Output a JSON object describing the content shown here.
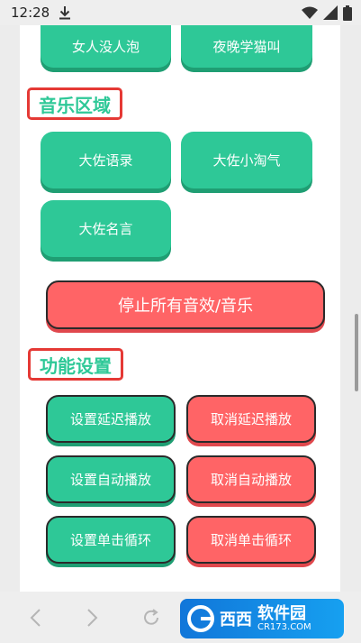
{
  "status_bar": {
    "time": "12:28"
  },
  "buttons_top": [
    {
      "label": "女人没人泡"
    },
    {
      "label": "夜晚学猫叫"
    }
  ],
  "music_section": {
    "title": "音乐区域",
    "buttons": [
      {
        "label": "大佐语录"
      },
      {
        "label": "大佐小淘气"
      },
      {
        "label": "大佐名言"
      }
    ]
  },
  "stop_button": {
    "label": "停止所有音效/音乐"
  },
  "settings_section": {
    "title": "功能设置",
    "rows": [
      {
        "set": "设置延迟播放",
        "cancel": "取消延迟播放"
      },
      {
        "set": "设置自动播放",
        "cancel": "取消自动播放"
      },
      {
        "set": "设置单击循环",
        "cancel": "取消单击循环"
      }
    ]
  },
  "watermark": {
    "brand": "西西",
    "name": "软件园",
    "url": "CR173.COM"
  },
  "colors": {
    "green": "#2ec897",
    "red": "#ff6466",
    "border_red": "#e53935"
  }
}
